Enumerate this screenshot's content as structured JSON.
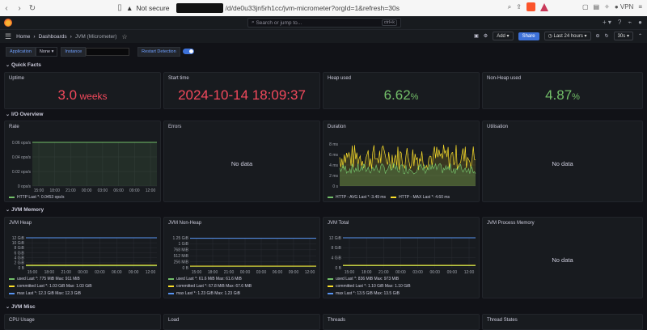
{
  "browser": {
    "not_secure": "Not secure",
    "url_tail": "/d/de0u33jn5rh1cc/jvm-micrometer?orgId=1&refresh=30s",
    "vpn": "VPN"
  },
  "topnav": {
    "search_placeholder": "Search or jump to...",
    "search_shortcut": "ctrl+k"
  },
  "breadcrumb": {
    "home": "Home",
    "dashboards": "Dashboards",
    "current": "JVM (Micrometer)"
  },
  "toolbar": {
    "add": "Add",
    "share": "Share",
    "timerange": "Last 24 hours",
    "refresh": "30s"
  },
  "variables": {
    "application_label": "Application",
    "application_value": "None",
    "instance_label": "Instance",
    "restart_label": "Restart Detection"
  },
  "rows": {
    "quick_facts": "Quick Facts",
    "io_overview": "I/O Overview",
    "jvm_memory": "JVM Memory",
    "jvm_misc": "JVM Misc"
  },
  "stats": {
    "uptime": {
      "title": "Uptime",
      "value": "3.0",
      "unit": " weeks",
      "color": "#f2495c"
    },
    "start_time": {
      "title": "Start time",
      "value": "2024-10-14 18:09:37",
      "color": "#f2495c"
    },
    "heap_used": {
      "title": "Heap used",
      "value": "6.62",
      "unit": "%",
      "color": "#73bf69"
    },
    "nonheap_used": {
      "title": "Non-Heap used",
      "value": "4.87",
      "unit": "%",
      "color": "#73bf69"
    }
  },
  "panels": {
    "rate": "Rate",
    "errors": "Errors",
    "duration": "Duration",
    "utilisation": "Utilisation",
    "jvm_heap": "JVM Heap",
    "jvm_nonheap": "JVM Non-Heap",
    "jvm_total": "JVM Total",
    "jvm_process_memory": "JVM Process Memory",
    "cpu_usage": "CPU Usage",
    "load": "Load",
    "threads": "Threads",
    "thread_states": "Thread States",
    "no_data": "No data"
  },
  "colors": {
    "green": "#73bf69",
    "yellow": "#fade2a",
    "blue": "#5794f2",
    "red": "#f2495c"
  },
  "chart_data": [
    {
      "type": "line",
      "panel": "Rate",
      "x": [
        "15:00",
        "18:00",
        "21:00",
        "00:00",
        "03:00",
        "06:00",
        "09:00",
        "12:00"
      ],
      "yticks": [
        "0 ops/s",
        "0.02 ops/s",
        "0.04 ops/s",
        "0.06 ops/s"
      ],
      "ylim": [
        0,
        0.06
      ],
      "series": [
        {
          "name": "HTTP",
          "color": "#73bf69",
          "values": [
            0.06,
            0.06,
            0.06,
            0.06,
            0.06,
            0.06,
            0.06,
            0.06
          ]
        }
      ],
      "legend": [
        "HTTP  Last *: 0.0453 ops/s"
      ]
    },
    {
      "type": "line",
      "panel": "Duration",
      "yticks": [
        "0 s",
        "2 ms",
        "4 ms",
        "6 ms",
        "8 ms"
      ],
      "ylim": [
        0,
        8
      ],
      "series": [
        {
          "name": "HTTP - AVG",
          "color": "#73bf69"
        },
        {
          "name": "HTTP - MAX",
          "color": "#fade2a"
        }
      ],
      "legend": [
        "HTTP - AVG  Last *: 3.49 ms",
        "HTTP - MAX  Last *: 4.60 ms"
      ]
    },
    {
      "type": "line",
      "panel": "JVM Heap",
      "x": [
        "15:00",
        "18:00",
        "21:00",
        "00:00",
        "03:00",
        "06:00",
        "09:00",
        "12:00"
      ],
      "yticks": [
        "0 B",
        "2 GiB",
        "4 GiB",
        "6 GiB",
        "8 GiB",
        "10 GiB",
        "12 GiB"
      ],
      "ylim": [
        0,
        12.3
      ],
      "series": [
        {
          "name": "used",
          "color": "#73bf69",
          "values": [
            0.8,
            0.8,
            0.8,
            0.8,
            0.8,
            0.8,
            0.8,
            0.8
          ]
        },
        {
          "name": "committed",
          "color": "#fade2a",
          "values": [
            1.03,
            1.03,
            1.03,
            1.03,
            1.03,
            1.03,
            1.03,
            1.03
          ]
        },
        {
          "name": "max",
          "color": "#5794f2",
          "values": [
            12.3,
            12.3,
            12.3,
            12.3,
            12.3,
            12.3,
            12.3,
            12.3
          ]
        }
      ],
      "legend": [
        "used  Last *: 775 MiB  Max: 911 MiB",
        "committed  Last *: 1.03 GiB  Max: 1.03 GiB",
        "max  Last *: 12.3 GiB  Max: 12.3 GiB"
      ]
    },
    {
      "type": "line",
      "panel": "JVM Non-Heap",
      "x": [
        "15:00",
        "18:00",
        "21:00",
        "00:00",
        "03:00",
        "06:00",
        "09:00",
        "12:00"
      ],
      "yticks": [
        "0 B",
        "256 MiB",
        "512 MiB",
        "768 MiB",
        "1 GiB",
        "1.25 GiB"
      ],
      "ylim": [
        0,
        1.25
      ],
      "series": [
        {
          "name": "used",
          "color": "#73bf69",
          "values": [
            0.06,
            0.06,
            0.06,
            0.06,
            0.06,
            0.06,
            0.06,
            0.06
          ]
        },
        {
          "name": "committed",
          "color": "#fade2a",
          "values": [
            0.066,
            0.066,
            0.066,
            0.066,
            0.066,
            0.066,
            0.066,
            0.066
          ]
        },
        {
          "name": "max",
          "color": "#5794f2",
          "values": [
            1.23,
            1.23,
            1.23,
            1.23,
            1.23,
            1.23,
            1.23,
            1.23
          ]
        }
      ],
      "legend": [
        "used  Last *: 61.6 MiB  Max: 61.6 MiB",
        "committed  Last *: 67.8 MiB  Max: 67.6 MiB",
        "max  Last *: 1.23 GiB  Max: 1.23 GiB"
      ]
    },
    {
      "type": "line",
      "panel": "JVM Total",
      "x": [
        "15:00",
        "18:00",
        "21:00",
        "00:00",
        "03:00",
        "06:00",
        "09:00",
        "12:00"
      ],
      "yticks": [
        "0 B",
        "4 GiB",
        "8 GiB",
        "12 GiB"
      ],
      "ylim": [
        0,
        13.5
      ],
      "series": [
        {
          "name": "used",
          "color": "#73bf69",
          "values": [
            0.9,
            0.9,
            0.9,
            0.9,
            0.9,
            0.9,
            0.9,
            0.9
          ]
        },
        {
          "name": "committed",
          "color": "#fade2a",
          "values": [
            1.1,
            1.1,
            1.1,
            1.1,
            1.1,
            1.1,
            1.1,
            1.1
          ]
        },
        {
          "name": "max",
          "color": "#5794f2",
          "values": [
            13.5,
            13.5,
            13.5,
            13.5,
            13.5,
            13.5,
            13.5,
            13.5
          ]
        }
      ],
      "legend": [
        "used  Last *: 836 MiB  Max: 973 MiB",
        "committed  Last *: 1.10 GiB  Max: 1.10 GiB",
        "max  Last *: 13.5 GiB  Max: 13.5 GiB"
      ]
    }
  ]
}
